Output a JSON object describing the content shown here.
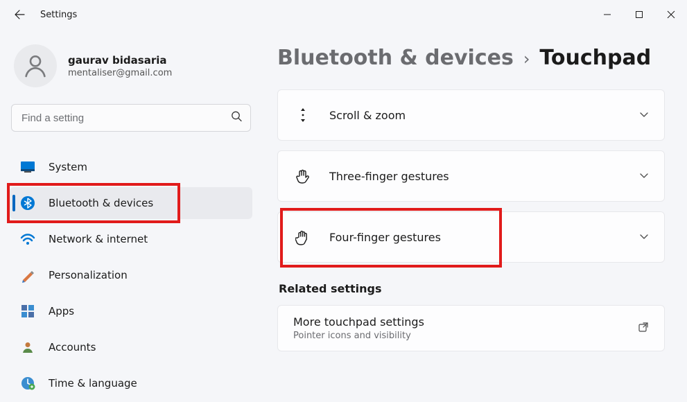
{
  "app_title": "Settings",
  "user": {
    "name": "gaurav bidasaria",
    "email": "mentaliser@gmail.com"
  },
  "search": {
    "placeholder": "Find a setting"
  },
  "nav": [
    {
      "key": "system",
      "label": "System"
    },
    {
      "key": "bluetooth",
      "label": "Bluetooth & devices",
      "selected": true
    },
    {
      "key": "network",
      "label": "Network & internet"
    },
    {
      "key": "personalization",
      "label": "Personalization"
    },
    {
      "key": "apps",
      "label": "Apps"
    },
    {
      "key": "accounts",
      "label": "Accounts"
    },
    {
      "key": "time",
      "label": "Time & language"
    }
  ],
  "breadcrumb": {
    "parent": "Bluetooth & devices",
    "current": "Touchpad"
  },
  "cards": [
    {
      "key": "scroll",
      "label": "Scroll & zoom"
    },
    {
      "key": "three",
      "label": "Three-finger gestures"
    },
    {
      "key": "four",
      "label": "Four-finger gestures"
    }
  ],
  "related": {
    "heading": "Related settings",
    "item": {
      "title": "More touchpad settings",
      "subtitle": "Pointer icons and visibility"
    }
  }
}
